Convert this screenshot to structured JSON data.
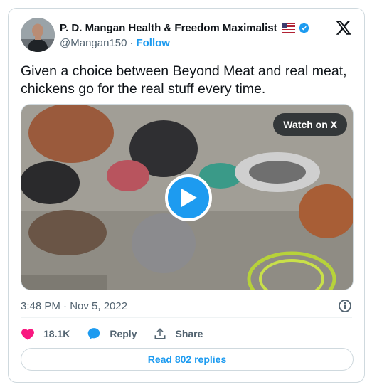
{
  "author": {
    "display_name": "P. D. Mangan Health & Freedom Maximalist",
    "handle": "@Mangan150",
    "separator": "·",
    "follow_label": "Follow",
    "flag_icon": "us-flag-icon",
    "verified_icon": "verified-badge-icon",
    "verified_color": "#1d9bf0"
  },
  "tweet": {
    "text": "Given a choice between Beyond Meat and real meat, chickens go for the real stuff every time.",
    "timestamp": "3:48 PM · Nov 5, 2022"
  },
  "media": {
    "type": "video",
    "watch_label": "Watch on X",
    "play_icon": "play-icon"
  },
  "actions": {
    "like_count": "18.1K",
    "reply_label": "Reply",
    "share_label": "Share",
    "like_color": "#f91880",
    "reply_color": "#1d9bf0"
  },
  "footer": {
    "read_replies_label": "Read 802 replies"
  },
  "colors": {
    "accent": "#1d9bf0",
    "text_primary": "#0f1419",
    "text_secondary": "#536471",
    "border": "#cfd9de"
  }
}
